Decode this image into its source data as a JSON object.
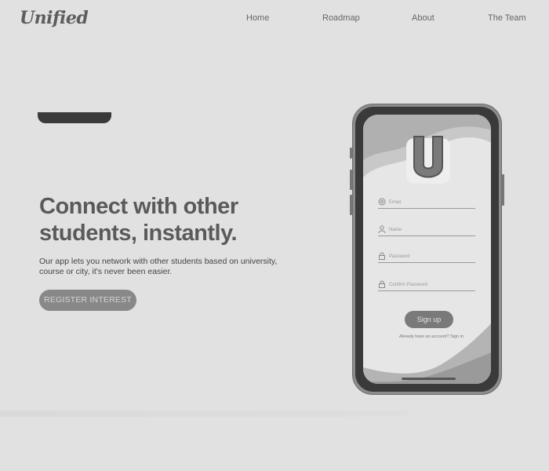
{
  "brand": {
    "name": "Unified"
  },
  "nav": {
    "items": [
      "Home",
      "Roadmap",
      "About",
      "The Team"
    ]
  },
  "hero": {
    "title_line1": "Connect with other",
    "title_line2": "students, instantly.",
    "subtitle": "Our app lets you network with other students based on university, course or city, it's never been easier.",
    "cta_label": "REGISTER INTEREST"
  },
  "phone_app": {
    "logo_letter": "U",
    "fields": [
      {
        "placeholder": "Email",
        "icon": "at-icon"
      },
      {
        "placeholder": "Name",
        "icon": "user-icon"
      },
      {
        "placeholder": "Password",
        "icon": "lock-icon"
      },
      {
        "placeholder": "Confirm Password",
        "icon": "lock-icon"
      }
    ],
    "signup_label": "Sign up",
    "signin_prompt": "Already have an account? Sign in"
  },
  "colors": {
    "background": "#e1e1e1",
    "cta": "#888888",
    "phone_frame": "#3a3a3a",
    "signup_button": "#7a7a7a"
  }
}
